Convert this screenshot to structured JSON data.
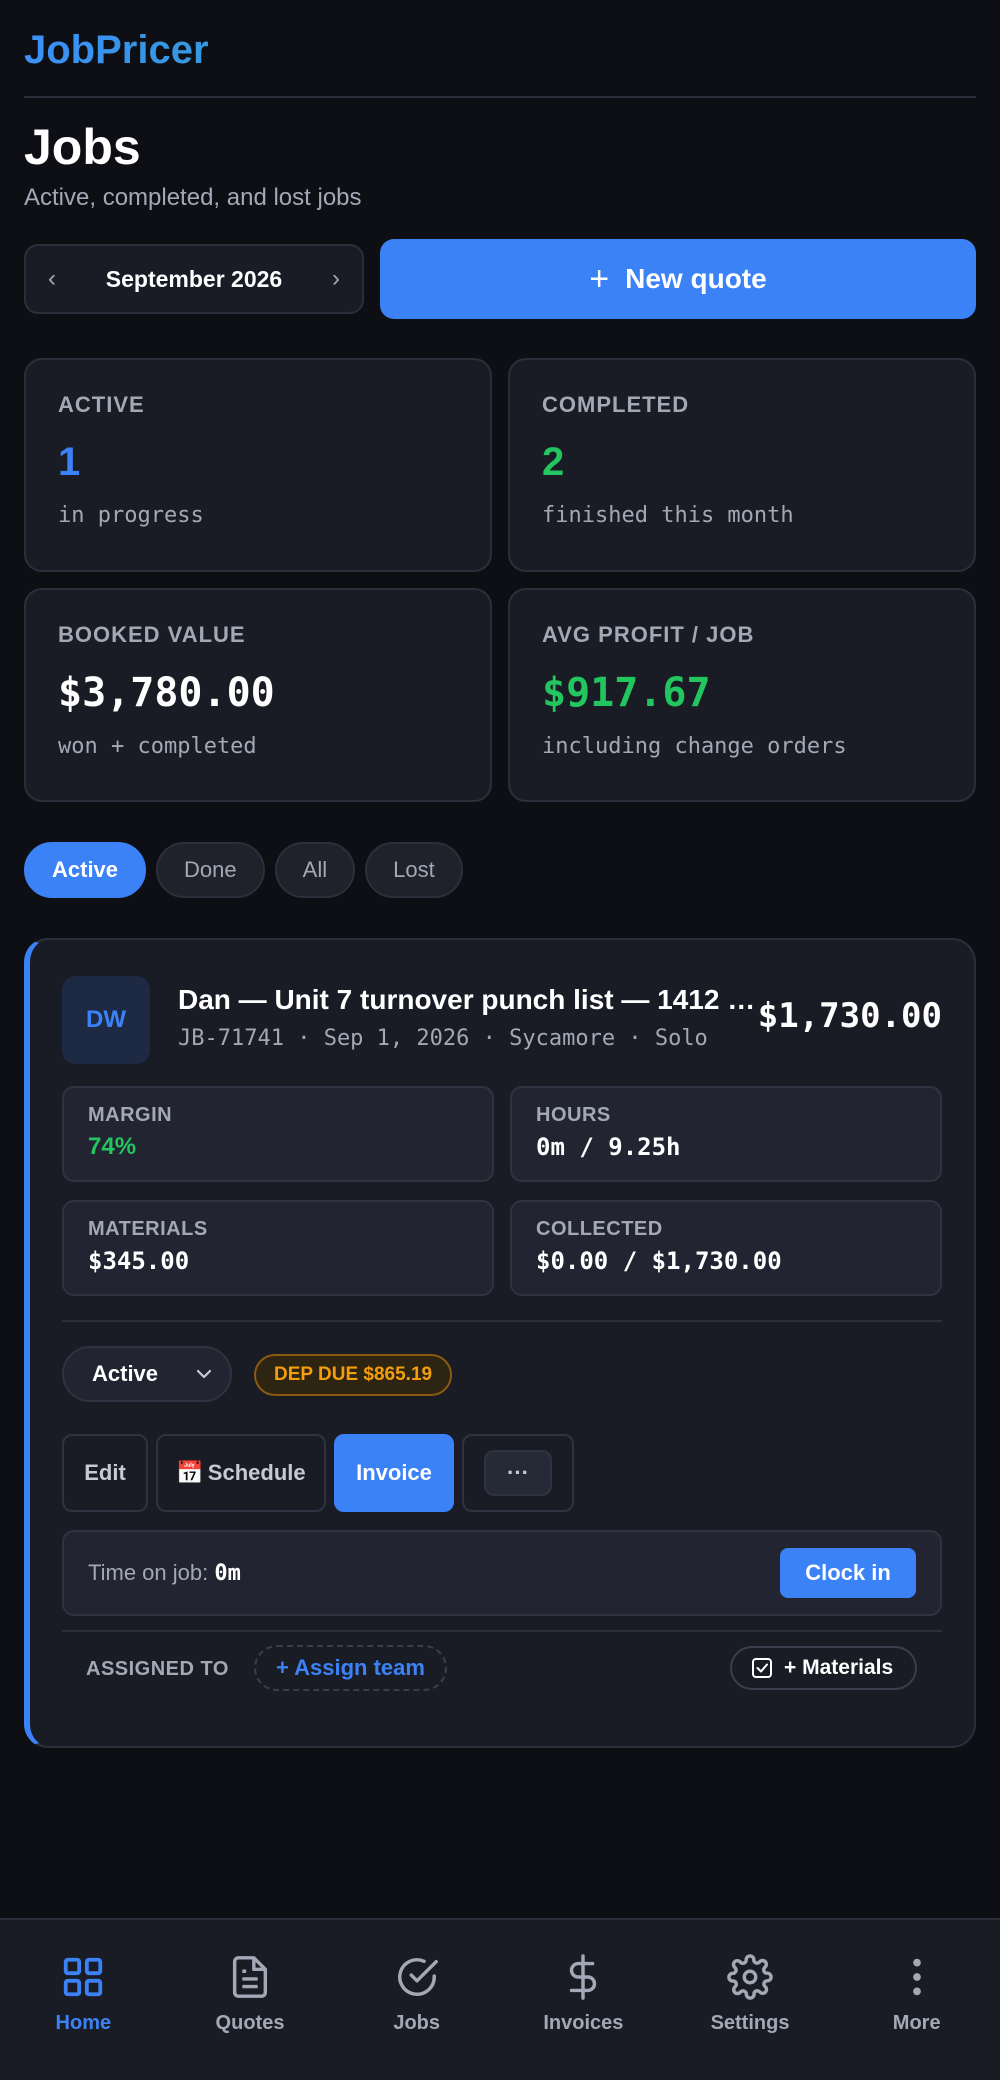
{
  "app": {
    "logo": "JobPricer"
  },
  "page": {
    "title": "Jobs",
    "subtitle": "Active, completed, and lost jobs"
  },
  "month_picker": {
    "prev": "‹",
    "label": "September 2026",
    "next": "›"
  },
  "new_quote": {
    "icon": "+",
    "label": "New quote"
  },
  "stats": {
    "active": {
      "label": "ACTIVE",
      "value": "1",
      "sub": "in progress",
      "color": "#3b82f6"
    },
    "completed": {
      "label": "COMPLETED",
      "value": "2",
      "sub": "finished this month",
      "color": "#22c55e"
    },
    "booked": {
      "label": "BOOKED VALUE",
      "value": "$3,780.00",
      "sub": "won + completed",
      "color": "#ffffff"
    },
    "avg_profit": {
      "label": "AVG PROFIT / JOB",
      "value": "$917.67",
      "sub": "including change orders",
      "color": "#22c55e"
    }
  },
  "filters": [
    {
      "label": "Active",
      "selected": true
    },
    {
      "label": "Done",
      "selected": false
    },
    {
      "label": "All",
      "selected": false
    },
    {
      "label": "Lost",
      "selected": false
    }
  ],
  "job": {
    "initials": "DW",
    "title": "Dan — Unit 7 turnover punch list — 1412 C...",
    "meta": "JB-71741 · Sep 1, 2026 · Sycamore · Solo",
    "price": "$1,730.00",
    "margin": {
      "label": "MARGIN",
      "value": "74%"
    },
    "hours": {
      "label": "HOURS",
      "value": "0m / 9.25h"
    },
    "materials": {
      "label": "MATERIALS",
      "value": "$345.00"
    },
    "collected": {
      "label": "COLLECTED",
      "value": "$0.00 / $1,730.00"
    },
    "status": "Active",
    "badge": "DEP DUE $865.19",
    "actions": {
      "edit": "Edit",
      "schedule_icon": "📅",
      "schedule": "Schedule",
      "invoice": "Invoice",
      "more": "···"
    },
    "timer": {
      "label": "Time on job: ",
      "value": "0m",
      "clock_in": "Clock in"
    },
    "assigned_label": "ASSIGNED TO",
    "assign_team": "+ Assign team",
    "add_materials": "+ Materials"
  },
  "nav": [
    {
      "label": "Home",
      "icon": "grid-icon",
      "active": true
    },
    {
      "label": "Quotes",
      "icon": "document-icon",
      "active": false
    },
    {
      "label": "Jobs",
      "icon": "check-circle-icon",
      "active": false
    },
    {
      "label": "Invoices",
      "icon": "dollar-icon",
      "active": false
    },
    {
      "label": "Settings",
      "icon": "gear-icon",
      "active": false
    },
    {
      "label": "More",
      "icon": "more-vertical-icon",
      "active": false
    }
  ]
}
